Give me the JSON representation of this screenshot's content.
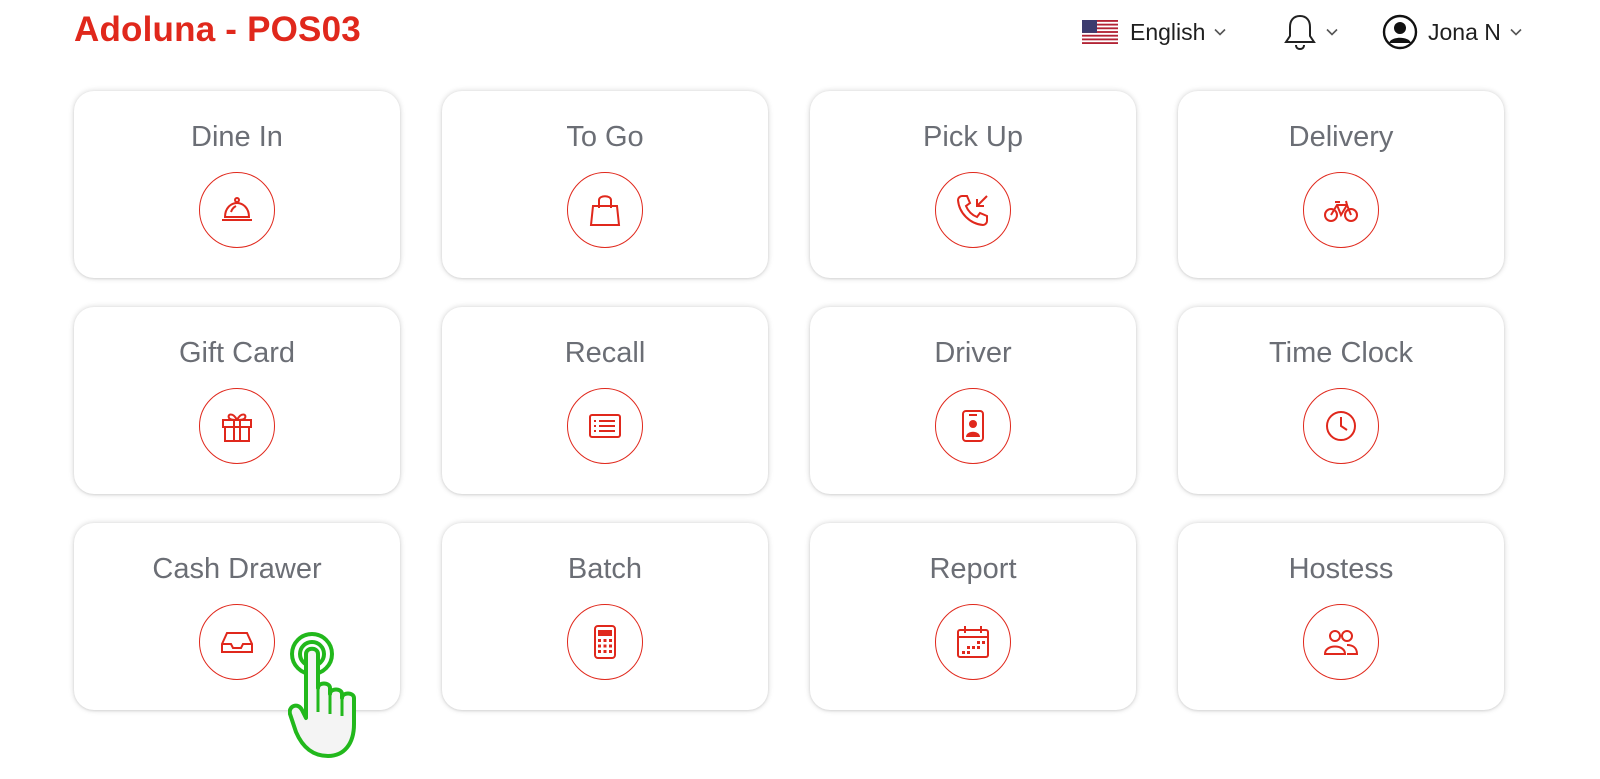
{
  "header": {
    "app_title": "Adoluna - POS03",
    "language": "English",
    "user_name": "Jona N"
  },
  "tiles": [
    {
      "label": "Dine In",
      "icon": "cloche-icon"
    },
    {
      "label": "To Go",
      "icon": "shopping-bag-icon"
    },
    {
      "label": "Pick Up",
      "icon": "incoming-call-icon"
    },
    {
      "label": "Delivery",
      "icon": "bicycle-icon"
    },
    {
      "label": "Gift Card",
      "icon": "gift-icon"
    },
    {
      "label": "Recall",
      "icon": "receipt-list-icon"
    },
    {
      "label": "Driver",
      "icon": "id-badge-icon"
    },
    {
      "label": "Time Clock",
      "icon": "clock-icon"
    },
    {
      "label": "Cash Drawer",
      "icon": "drawer-tray-icon"
    },
    {
      "label": "Batch",
      "icon": "calculator-icon"
    },
    {
      "label": "Report",
      "icon": "calendar-report-icon"
    },
    {
      "label": "Hostess",
      "icon": "people-icon"
    }
  ],
  "colors": {
    "accent": "#e0281c",
    "label_gray": "#6b6e75",
    "pointer_green": "#22b81c"
  }
}
